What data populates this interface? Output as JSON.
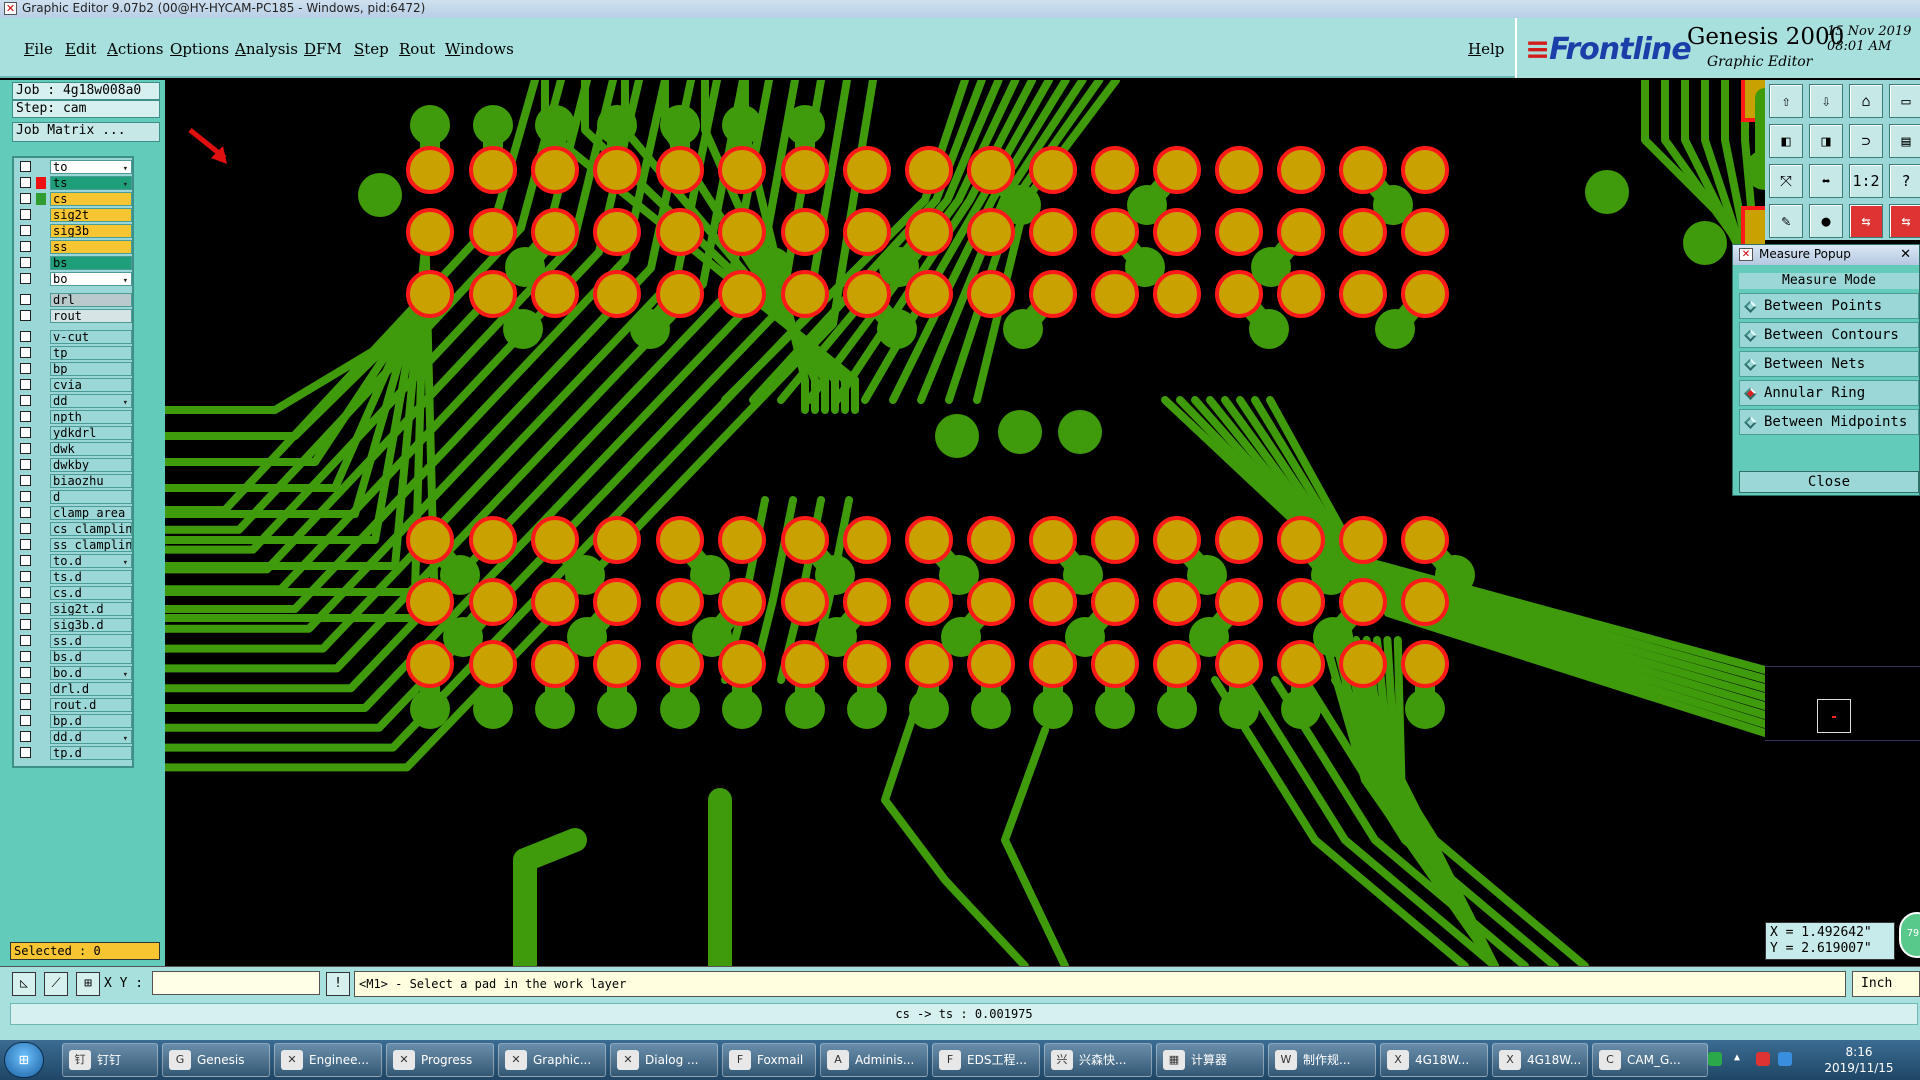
{
  "window": {
    "title": "Graphic Editor 9.07b2 (00@HY-HYCAM-PC185 - Windows, pid:6472)"
  },
  "menu": {
    "file": "File",
    "edit": "Edit",
    "actions": "Actions",
    "options": "Options",
    "analysis": "Analysis",
    "dfm": "DFM",
    "step": "Step",
    "rout": "Rout",
    "windows": "Windows",
    "help": "Help"
  },
  "brand": {
    "logo": "Frontline",
    "product": "Genesis 2000",
    "subtitle": "Graphic Editor",
    "date": "15 Nov 2019",
    "time": "08:01 AM"
  },
  "job": {
    "job_line": "Job : 4g18w008a0",
    "step_line": "Step: cam",
    "matrix_button": "Job Matrix ..."
  },
  "layers": [
    {
      "name": "to",
      "color": "#ffffff",
      "sw": "",
      "mark": "▾"
    },
    {
      "name": "ts",
      "color": "#1f9e7a",
      "sw": "#ee1111",
      "mark": "▾",
      "active": true
    },
    {
      "name": "cs",
      "color": "#f7c531",
      "sw": "#2f9d2f",
      "mark": ""
    },
    {
      "name": "sig2t",
      "color": "#f7c531",
      "sw": "",
      "mark": ""
    },
    {
      "name": "sig3b",
      "color": "#f7c531",
      "sw": "",
      "mark": ""
    },
    {
      "name": "ss",
      "color": "#f7c531",
      "sw": "",
      "mark": ""
    },
    {
      "name": "bs",
      "color": "#1f9e7a",
      "sw": "",
      "mark": ""
    },
    {
      "name": "bo",
      "color": "#ffffff",
      "sw": "",
      "mark": "▾"
    },
    {
      "name": "drl",
      "color": "#b9c9cc",
      "sw": "",
      "mark": ""
    },
    {
      "name": "rout",
      "color": "#d6e4e6",
      "sw": "",
      "mark": ""
    },
    {
      "name": "v-cut",
      "color": "",
      "sw": "",
      "mark": ""
    },
    {
      "name": "tp",
      "color": "",
      "sw": "",
      "mark": ""
    },
    {
      "name": "bp",
      "color": "",
      "sw": "",
      "mark": ""
    },
    {
      "name": "cvia",
      "color": "",
      "sw": "",
      "mark": ""
    },
    {
      "name": "dd",
      "color": "",
      "sw": "",
      "mark": "▾"
    },
    {
      "name": "npth",
      "color": "",
      "sw": "",
      "mark": ""
    },
    {
      "name": "ydkdrl",
      "color": "",
      "sw": "",
      "mark": ""
    },
    {
      "name": "dwk",
      "color": "",
      "sw": "",
      "mark": ""
    },
    {
      "name": "dwkby",
      "color": "",
      "sw": "",
      "mark": ""
    },
    {
      "name": "biaozhu",
      "color": "",
      "sw": "",
      "mark": ""
    },
    {
      "name": "d",
      "color": "",
      "sw": "",
      "mark": ""
    },
    {
      "name": "clamp_area",
      "color": "",
      "sw": "",
      "mark": ""
    },
    {
      "name": "cs_clampline",
      "color": "",
      "sw": "",
      "mark": ""
    },
    {
      "name": "ss_clampline",
      "color": "",
      "sw": "",
      "mark": ""
    },
    {
      "name": "to.d",
      "color": "",
      "sw": "",
      "mark": "▾"
    },
    {
      "name": "ts.d",
      "color": "",
      "sw": "",
      "mark": ""
    },
    {
      "name": "cs.d",
      "color": "",
      "sw": "",
      "mark": ""
    },
    {
      "name": "sig2t.d",
      "color": "",
      "sw": "",
      "mark": ""
    },
    {
      "name": "sig3b.d",
      "color": "",
      "sw": "",
      "mark": ""
    },
    {
      "name": "ss.d",
      "color": "",
      "sw": "",
      "mark": ""
    },
    {
      "name": "bs.d",
      "color": "",
      "sw": "",
      "mark": ""
    },
    {
      "name": "bo.d",
      "color": "",
      "sw": "",
      "mark": "▾"
    },
    {
      "name": "drl.d",
      "color": "",
      "sw": "",
      "mark": ""
    },
    {
      "name": "rout.d",
      "color": "",
      "sw": "",
      "mark": ""
    },
    {
      "name": "bp.d",
      "color": "",
      "sw": "",
      "mark": ""
    },
    {
      "name": "dd.d",
      "color": "",
      "sw": "",
      "mark": "▾"
    },
    {
      "name": "tp.d",
      "color": "",
      "sw": "",
      "mark": ""
    }
  ],
  "selected": "Selected : 0",
  "canvas": {
    "copper_color": "#3f9a0c",
    "pad_color": "#c9a100",
    "ring_color": "#ff1a1a",
    "arrow_color": "#e01010"
  },
  "tools": [
    "⇧",
    "⇩",
    "⌂",
    "▭",
    "◧",
    "◨",
    "⊃",
    "▤",
    "⤧",
    "⬌",
    "1:2",
    "?",
    "✎",
    "●",
    "⇆",
    "⇆"
  ],
  "measure": {
    "title": "Measure Popup",
    "mode_label": "Measure Mode",
    "options": [
      "Between Points",
      "Between Contours",
      "Between Nets",
      "Annular Ring",
      "Between Midpoints"
    ],
    "selected_option": "Annular Ring",
    "close": "Close"
  },
  "coords": {
    "x": "X = 1.492642\"",
    "y": "Y = 2.619007\""
  },
  "bubble": "79",
  "cmd": {
    "xy_label": "X Y :",
    "xy_value": "",
    "prompt": "<M1> - Select a pad in the work layer",
    "units": "Inch"
  },
  "status": "cs -> ts : 0.001975",
  "taskbar": {
    "start": "⊞",
    "tasks": [
      {
        "label": "钉钉",
        "icon": "钉"
      },
      {
        "label": "Genesis",
        "icon": "G"
      },
      {
        "label": "Enginee...",
        "icon": "✕"
      },
      {
        "label": "Progress",
        "icon": "✕"
      },
      {
        "label": "Graphic...",
        "icon": "✕"
      },
      {
        "label": "Dialog ...",
        "icon": "✕"
      },
      {
        "label": "Foxmail",
        "icon": "F"
      },
      {
        "label": "Adminis...",
        "icon": "A"
      },
      {
        "label": "EDS工程...",
        "icon": "F"
      },
      {
        "label": "兴森快...",
        "icon": "兴"
      },
      {
        "label": "计算器",
        "icon": "▦"
      },
      {
        "label": "制作规...",
        "icon": "W"
      },
      {
        "label": "4G18W...",
        "icon": "X"
      },
      {
        "label": "4G18W...",
        "icon": "X"
      },
      {
        "label": "CAM_G...",
        "icon": "C"
      }
    ],
    "time": "8:16",
    "date": "2019/11/15"
  }
}
